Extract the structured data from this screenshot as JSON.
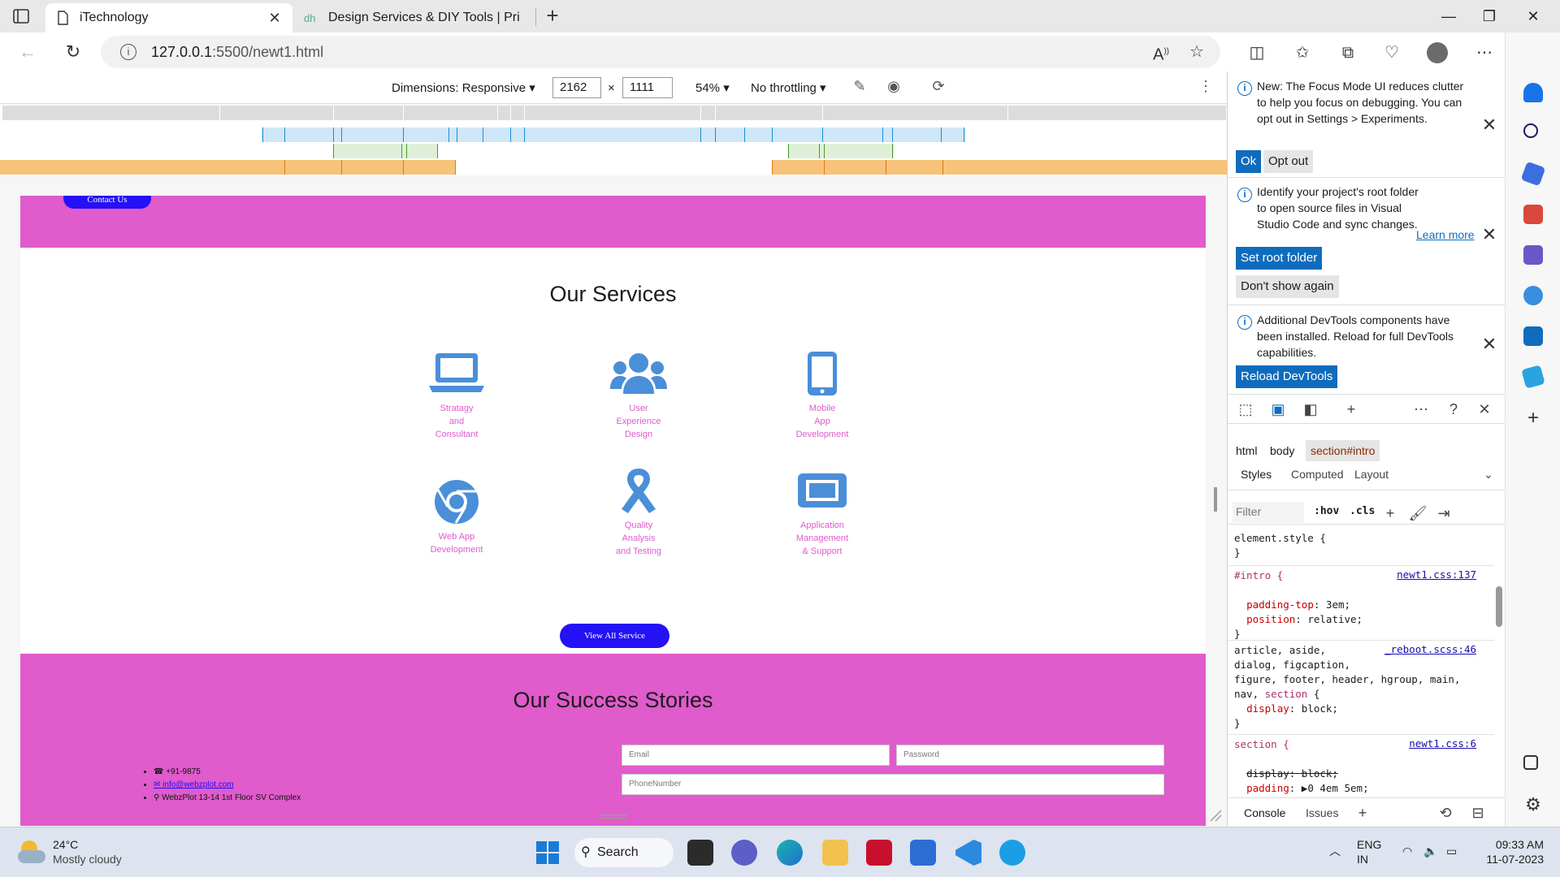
{
  "browser": {
    "tabs": [
      {
        "title": "iTechnology",
        "active": true
      },
      {
        "title": "Design Services & DIY Tools | Pri",
        "active": false
      }
    ],
    "address": {
      "host": "127.0.0.1",
      "path": ":5500/newt1.html"
    }
  },
  "device_toolbar": {
    "dimensions_label": "Dimensions: Responsive",
    "width": "2162",
    "times": "×",
    "height": "1111",
    "zoom": "54%",
    "throttling": "No throttling"
  },
  "page": {
    "contact_button": "Contact Us",
    "services_heading": "Our Services",
    "services": [
      {
        "label": "Stratagy and Consultant",
        "lines": [
          "Stratagy",
          "and",
          "Consultant"
        ],
        "icon": "laptop-icon"
      },
      {
        "label": "User Experience Design",
        "lines": [
          "User",
          "Experience",
          "Design"
        ],
        "icon": "users-icon"
      },
      {
        "label": "Mobile App Development",
        "lines": [
          "Mobile",
          "App",
          "Development"
        ],
        "icon": "mobile-icon"
      },
      {
        "label": "Web App Development",
        "lines": [
          "Web App",
          "Development"
        ],
        "icon": "chrome-icon"
      },
      {
        "label": "Quality Analysis and Testing",
        "lines": [
          "Quality",
          "Analysis",
          "and Testing"
        ],
        "icon": "ribbon-icon"
      },
      {
        "label": "Application Management & Support",
        "lines": [
          "Application",
          "Management",
          "& Support"
        ],
        "icon": "display-icon"
      }
    ],
    "view_all_button": "View All Service",
    "stories_heading": "Our Success Stories",
    "contact": {
      "phone": "+91-9875",
      "email": "info@webzplot.com",
      "address": "WebzPlot 13-14 1st Floor SV Complex"
    },
    "form": {
      "email_placeholder": "Email",
      "password_placeholder": "Password",
      "phone_placeholder": "PhoneNumber"
    },
    "accent_color": "#e05bcc",
    "button_color": "#2411f5"
  },
  "devtools": {
    "notices": [
      {
        "text": "New: The Focus Mode UI reduces clutter to help you focus on debugging. You can opt out in Settings > Experiments.",
        "buttons": [
          "Ok",
          "Opt out"
        ]
      },
      {
        "text": "Identify your project's root folder to open source files in Visual Studio Code and sync changes.",
        "link": "Learn more",
        "buttons": [
          "Set root folder",
          "Don't show again"
        ]
      },
      {
        "text": "Additional DevTools components have been installed. Reload for full DevTools capabilities.",
        "buttons": [
          "Reload DevTools"
        ]
      }
    ],
    "breadcrumbs": [
      "html",
      "body",
      "section#intro"
    ],
    "subtabs": [
      "Styles",
      "Computed",
      "Layout"
    ],
    "filter_placeholder": "Filter",
    "hov": ":hov",
    "cls": ".cls",
    "styles": {
      "element_style": "element.style {",
      "close_brace": "}",
      "rule1_selector": "#intro {",
      "rule1_source": "newt1.css:137",
      "rule1_p1_name": "padding-top",
      "rule1_p1_value": " 3em;",
      "rule1_p2_name": "position",
      "rule1_p2_value": " relative;",
      "rule2_selector_l1": "article, aside,",
      "rule2_selector_l2": "dialog, figcaption,",
      "rule2_selector_l3": "figure, footer, header, hgroup, main,",
      "rule2_selector_l4a": "nav, ",
      "rule2_selector_l4b": "section",
      "rule2_selector_l4c": " {",
      "rule2_source": "_reboot.scss:46",
      "rule2_p1_name": "display",
      "rule2_p1_value": " block;",
      "rule3_selector": "section {",
      "rule3_source": "newt1.css:6",
      "rule3_p1": "display: block;",
      "rule3_p2_name": "padding",
      "rule3_p2_value": " ▶0 4em 5em;"
    },
    "drawer_tabs": [
      "Console",
      "Issues"
    ]
  },
  "taskbar": {
    "weather_temp": "24°C",
    "weather_desc": "Mostly cloudy",
    "search_label": "Search",
    "lang_top": "ENG",
    "lang_bottom": "IN",
    "time": "09:33 AM",
    "date": "11-07-2023"
  }
}
